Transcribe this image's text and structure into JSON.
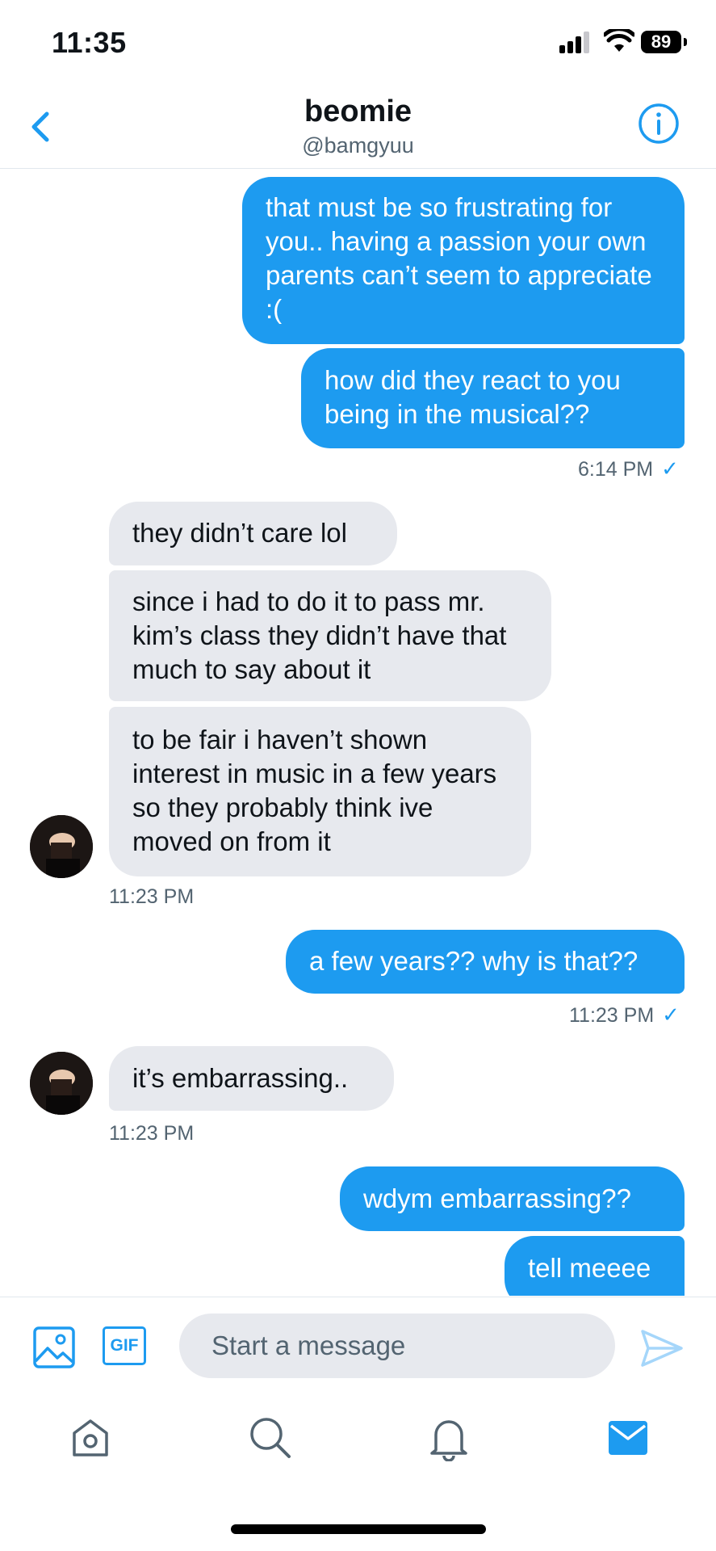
{
  "status_bar": {
    "time": "11:35",
    "battery": "89"
  },
  "header": {
    "title": "beomie",
    "handle": "@bamgyuu"
  },
  "messages": [
    {
      "text": "that must be so frustrating for you.. having a passion your own parents can’t seem to appreciate :("
    },
    {
      "text": "how did they react to you being in the musical??"
    },
    {
      "text": "they didn’t care lol"
    },
    {
      "text": "since i had to do it to pass mr. kim’s class they didn’t have that much to say about it"
    },
    {
      "text": "to be fair i haven’t shown interest in music in a few years so they probably think ive moved on from it"
    },
    {
      "text": "a few years?? why is that??"
    },
    {
      "text": "it’s embarrassing.."
    },
    {
      "text": "wdym embarrassing??"
    },
    {
      "text": "tell meeee"
    }
  ],
  "timestamps": {
    "t1": "6:14 PM",
    "t2": "11:23 PM",
    "t3": "11:23 PM",
    "t4": "11:23 PM"
  },
  "composer": {
    "placeholder": "Start a message",
    "gif_label": "GIF"
  },
  "tabs": [
    "home-icon",
    "search-icon",
    "bell-icon",
    "mail-icon"
  ],
  "colors": {
    "accent": "#1d9bf0",
    "incoming_bubble": "#e7e9ee",
    "secondary_text": "#536471"
  }
}
